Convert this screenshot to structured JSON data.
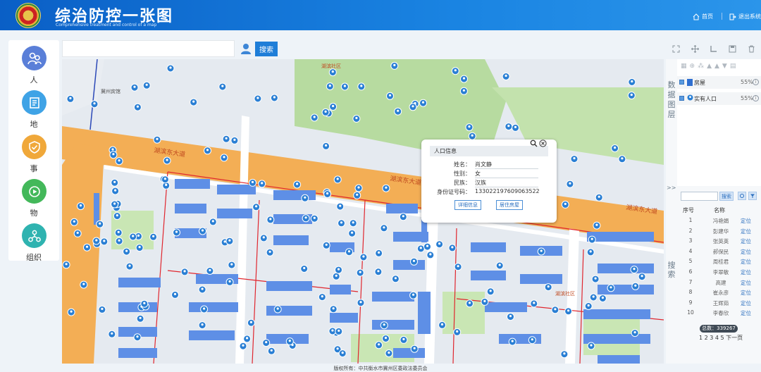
{
  "header": {
    "title": "综治防控一张图",
    "subtitle": "Comprehensive treatment and control of a map",
    "home_label": "首页",
    "logout_label": "退出系统"
  },
  "sidebar": {
    "items": [
      {
        "label": "人",
        "icon": "person-group-icon",
        "color": "#5a7fd8"
      },
      {
        "label": "地",
        "icon": "building-doc-icon",
        "color": "#3fa3e6"
      },
      {
        "label": "事",
        "icon": "shield-check-icon",
        "color": "#f0a83a"
      },
      {
        "label": "物",
        "icon": "video-camera-icon",
        "color": "#43b85a"
      },
      {
        "label": "组织",
        "icon": "org-network-icon",
        "color": "#2fb3b0"
      }
    ]
  },
  "search": {
    "placeholder": "",
    "button_label": "搜索"
  },
  "map": {
    "road_labels": [
      "湖滨东大道",
      "湖滨东大道",
      "湖滨东大道"
    ],
    "place_labels": [
      "湖滨社区",
      "冀州宾馆",
      "湖滨社区"
    ],
    "popup": {
      "title": "人口信息",
      "fields": [
        {
          "label": "姓名：",
          "value": "肖文静"
        },
        {
          "label": "性别：",
          "value": "女"
        },
        {
          "label": "民族：",
          "value": "汉族"
        },
        {
          "label": "身份证号码：",
          "value": "133022197609063522"
        }
      ],
      "detail_button": "详细信息",
      "residence_button": "居住房屋"
    }
  },
  "layer_panel": {
    "title_chars": [
      "数",
      "据",
      "图",
      "层"
    ],
    "layers": [
      {
        "name": "房屋",
        "opacity": "55%"
      },
      {
        "name": "实有人口",
        "opacity": "55%"
      }
    ],
    "collapse_label": ">>"
  },
  "search_panel": {
    "title_chars": [
      "搜",
      "索"
    ],
    "button_label": "搜索",
    "columns": [
      "序号",
      "名称"
    ],
    "rows": [
      {
        "num": "1",
        "name": "冯艳娟",
        "action": "定位"
      },
      {
        "num": "2",
        "name": "彭建华",
        "action": "定位"
      },
      {
        "num": "3",
        "name": "张英英",
        "action": "定位"
      },
      {
        "num": "4",
        "name": "郝保民",
        "action": "定位"
      },
      {
        "num": "5",
        "name": "周桂君",
        "action": "定位"
      },
      {
        "num": "6",
        "name": "李翠敏",
        "action": "定位"
      },
      {
        "num": "7",
        "name": "高建",
        "action": "定位"
      },
      {
        "num": "8",
        "name": "崔永彦",
        "action": "定位"
      },
      {
        "num": "9",
        "name": "王辉茹",
        "action": "定位"
      },
      {
        "num": "10",
        "name": "李春欣",
        "action": "定位"
      }
    ],
    "total": "总数：339267",
    "pager": "1 2 3 4 5 下一页"
  },
  "footer": {
    "copyright": "版权所有：中共衡水市冀州区委政法委员会"
  }
}
